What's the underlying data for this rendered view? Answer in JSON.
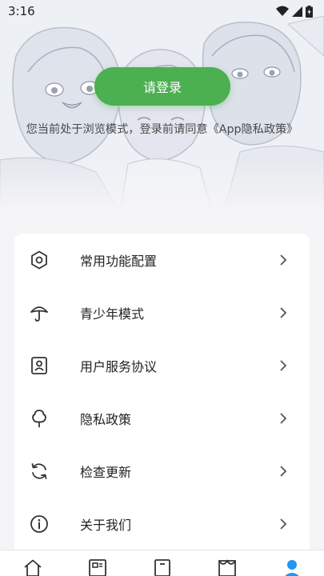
{
  "status_bar": {
    "time": "3:16",
    "icons": [
      "wifi-icon",
      "cell-signal-icon",
      "battery-charging-icon"
    ]
  },
  "header": {
    "login_button": "请登录",
    "notice": "您当前处于浏览模式，登录前请同意《App隐私政策》"
  },
  "menu": {
    "items": [
      {
        "label": "常用功能配置",
        "icon": "hexagon-settings-icon"
      },
      {
        "label": "青少年模式",
        "icon": "umbrella-icon"
      },
      {
        "label": "用户服务协议",
        "icon": "user-card-icon"
      },
      {
        "label": "隐私政策",
        "icon": "tree-icon"
      },
      {
        "label": "检查更新",
        "icon": "refresh-icon"
      },
      {
        "label": "关于我们",
        "icon": "info-icon"
      }
    ]
  },
  "bottom_nav": {
    "items": [
      "home-icon",
      "news-icon",
      "bookmark-icon",
      "store-icon",
      "profile-icon"
    ],
    "active_color": "#2196f3"
  },
  "colors": {
    "accent": "#4caf50",
    "background": "#f5f5f7"
  }
}
